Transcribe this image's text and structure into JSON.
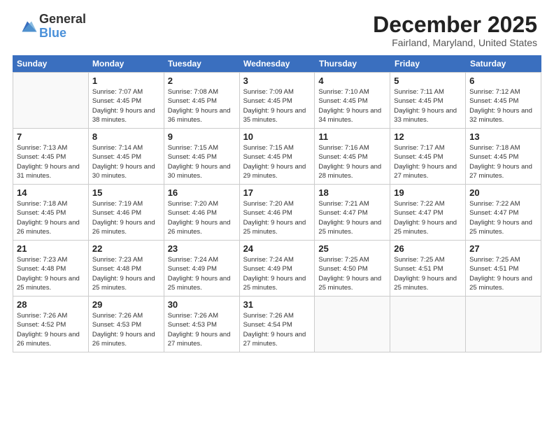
{
  "logo": {
    "general": "General",
    "blue": "Blue"
  },
  "title": "December 2025",
  "location": "Fairland, Maryland, United States",
  "days_of_week": [
    "Sunday",
    "Monday",
    "Tuesday",
    "Wednesday",
    "Thursday",
    "Friday",
    "Saturday"
  ],
  "weeks": [
    [
      {
        "day": "",
        "sunrise": "",
        "sunset": "",
        "daylight": ""
      },
      {
        "day": "1",
        "sunrise": "Sunrise: 7:07 AM",
        "sunset": "Sunset: 4:45 PM",
        "daylight": "Daylight: 9 hours and 38 minutes."
      },
      {
        "day": "2",
        "sunrise": "Sunrise: 7:08 AM",
        "sunset": "Sunset: 4:45 PM",
        "daylight": "Daylight: 9 hours and 36 minutes."
      },
      {
        "day": "3",
        "sunrise": "Sunrise: 7:09 AM",
        "sunset": "Sunset: 4:45 PM",
        "daylight": "Daylight: 9 hours and 35 minutes."
      },
      {
        "day": "4",
        "sunrise": "Sunrise: 7:10 AM",
        "sunset": "Sunset: 4:45 PM",
        "daylight": "Daylight: 9 hours and 34 minutes."
      },
      {
        "day": "5",
        "sunrise": "Sunrise: 7:11 AM",
        "sunset": "Sunset: 4:45 PM",
        "daylight": "Daylight: 9 hours and 33 minutes."
      },
      {
        "day": "6",
        "sunrise": "Sunrise: 7:12 AM",
        "sunset": "Sunset: 4:45 PM",
        "daylight": "Daylight: 9 hours and 32 minutes."
      }
    ],
    [
      {
        "day": "7",
        "sunrise": "Sunrise: 7:13 AM",
        "sunset": "Sunset: 4:45 PM",
        "daylight": "Daylight: 9 hours and 31 minutes."
      },
      {
        "day": "8",
        "sunrise": "Sunrise: 7:14 AM",
        "sunset": "Sunset: 4:45 PM",
        "daylight": "Daylight: 9 hours and 30 minutes."
      },
      {
        "day": "9",
        "sunrise": "Sunrise: 7:15 AM",
        "sunset": "Sunset: 4:45 PM",
        "daylight": "Daylight: 9 hours and 30 minutes."
      },
      {
        "day": "10",
        "sunrise": "Sunrise: 7:15 AM",
        "sunset": "Sunset: 4:45 PM",
        "daylight": "Daylight: 9 hours and 29 minutes."
      },
      {
        "day": "11",
        "sunrise": "Sunrise: 7:16 AM",
        "sunset": "Sunset: 4:45 PM",
        "daylight": "Daylight: 9 hours and 28 minutes."
      },
      {
        "day": "12",
        "sunrise": "Sunrise: 7:17 AM",
        "sunset": "Sunset: 4:45 PM",
        "daylight": "Daylight: 9 hours and 27 minutes."
      },
      {
        "day": "13",
        "sunrise": "Sunrise: 7:18 AM",
        "sunset": "Sunset: 4:45 PM",
        "daylight": "Daylight: 9 hours and 27 minutes."
      }
    ],
    [
      {
        "day": "14",
        "sunrise": "Sunrise: 7:18 AM",
        "sunset": "Sunset: 4:45 PM",
        "daylight": "Daylight: 9 hours and 26 minutes."
      },
      {
        "day": "15",
        "sunrise": "Sunrise: 7:19 AM",
        "sunset": "Sunset: 4:46 PM",
        "daylight": "Daylight: 9 hours and 26 minutes."
      },
      {
        "day": "16",
        "sunrise": "Sunrise: 7:20 AM",
        "sunset": "Sunset: 4:46 PM",
        "daylight": "Daylight: 9 hours and 26 minutes."
      },
      {
        "day": "17",
        "sunrise": "Sunrise: 7:20 AM",
        "sunset": "Sunset: 4:46 PM",
        "daylight": "Daylight: 9 hours and 25 minutes."
      },
      {
        "day": "18",
        "sunrise": "Sunrise: 7:21 AM",
        "sunset": "Sunset: 4:47 PM",
        "daylight": "Daylight: 9 hours and 25 minutes."
      },
      {
        "day": "19",
        "sunrise": "Sunrise: 7:22 AM",
        "sunset": "Sunset: 4:47 PM",
        "daylight": "Daylight: 9 hours and 25 minutes."
      },
      {
        "day": "20",
        "sunrise": "Sunrise: 7:22 AM",
        "sunset": "Sunset: 4:47 PM",
        "daylight": "Daylight: 9 hours and 25 minutes."
      }
    ],
    [
      {
        "day": "21",
        "sunrise": "Sunrise: 7:23 AM",
        "sunset": "Sunset: 4:48 PM",
        "daylight": "Daylight: 9 hours and 25 minutes."
      },
      {
        "day": "22",
        "sunrise": "Sunrise: 7:23 AM",
        "sunset": "Sunset: 4:48 PM",
        "daylight": "Daylight: 9 hours and 25 minutes."
      },
      {
        "day": "23",
        "sunrise": "Sunrise: 7:24 AM",
        "sunset": "Sunset: 4:49 PM",
        "daylight": "Daylight: 9 hours and 25 minutes."
      },
      {
        "day": "24",
        "sunrise": "Sunrise: 7:24 AM",
        "sunset": "Sunset: 4:49 PM",
        "daylight": "Daylight: 9 hours and 25 minutes."
      },
      {
        "day": "25",
        "sunrise": "Sunrise: 7:25 AM",
        "sunset": "Sunset: 4:50 PM",
        "daylight": "Daylight: 9 hours and 25 minutes."
      },
      {
        "day": "26",
        "sunrise": "Sunrise: 7:25 AM",
        "sunset": "Sunset: 4:51 PM",
        "daylight": "Daylight: 9 hours and 25 minutes."
      },
      {
        "day": "27",
        "sunrise": "Sunrise: 7:25 AM",
        "sunset": "Sunset: 4:51 PM",
        "daylight": "Daylight: 9 hours and 25 minutes."
      }
    ],
    [
      {
        "day": "28",
        "sunrise": "Sunrise: 7:26 AM",
        "sunset": "Sunset: 4:52 PM",
        "daylight": "Daylight: 9 hours and 26 minutes."
      },
      {
        "day": "29",
        "sunrise": "Sunrise: 7:26 AM",
        "sunset": "Sunset: 4:53 PM",
        "daylight": "Daylight: 9 hours and 26 minutes."
      },
      {
        "day": "30",
        "sunrise": "Sunrise: 7:26 AM",
        "sunset": "Sunset: 4:53 PM",
        "daylight": "Daylight: 9 hours and 27 minutes."
      },
      {
        "day": "31",
        "sunrise": "Sunrise: 7:26 AM",
        "sunset": "Sunset: 4:54 PM",
        "daylight": "Daylight: 9 hours and 27 minutes."
      },
      {
        "day": "",
        "sunrise": "",
        "sunset": "",
        "daylight": ""
      },
      {
        "day": "",
        "sunrise": "",
        "sunset": "",
        "daylight": ""
      },
      {
        "day": "",
        "sunrise": "",
        "sunset": "",
        "daylight": ""
      }
    ]
  ]
}
